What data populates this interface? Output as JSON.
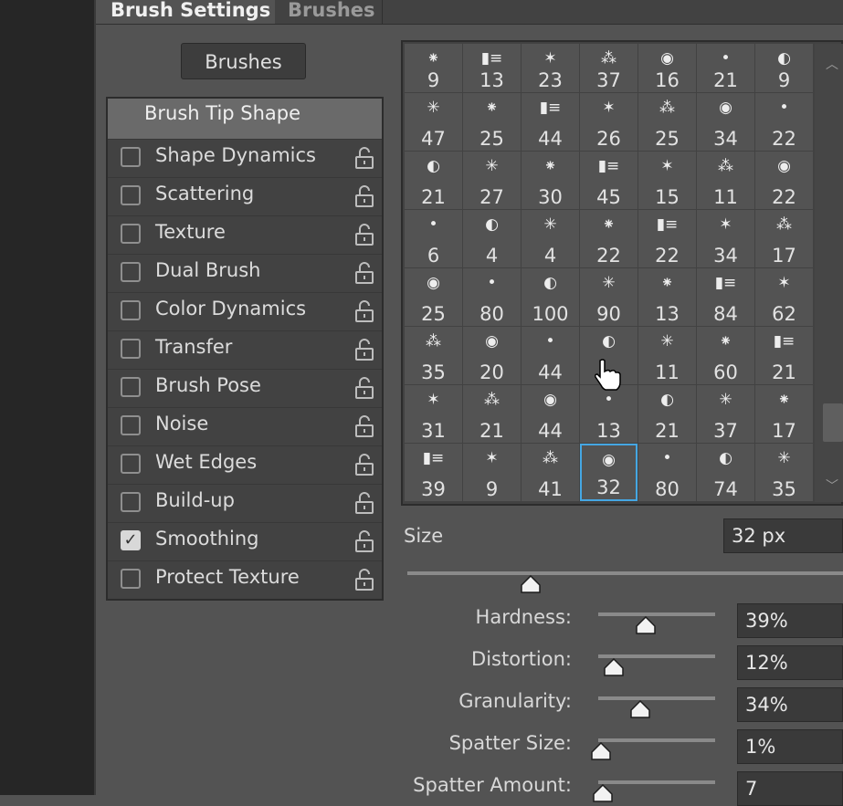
{
  "tabs": [
    {
      "label": "Brush Settings"
    },
    {
      "label": "Brushes"
    }
  ],
  "brushes_button": "Brushes",
  "tip_shape": "Brush Tip Shape",
  "options": [
    {
      "label": "Shape Dynamics",
      "checked": false
    },
    {
      "label": "Scattering",
      "checked": false
    },
    {
      "label": "Texture",
      "checked": false
    },
    {
      "label": "Dual Brush",
      "checked": false
    },
    {
      "label": "Color Dynamics",
      "checked": false
    },
    {
      "label": "Transfer",
      "checked": false
    },
    {
      "label": "Brush Pose",
      "checked": false
    },
    {
      "label": "Noise",
      "checked": false
    },
    {
      "label": "Wet Edges",
      "checked": false
    },
    {
      "label": "Build-up",
      "checked": false
    },
    {
      "label": "Smoothing",
      "checked": true
    },
    {
      "label": "Protect Texture",
      "checked": false
    }
  ],
  "brush_grid": [
    [
      "9",
      "13",
      "23",
      "37",
      "16",
      "21",
      "9"
    ],
    [
      "47",
      "25",
      "44",
      "26",
      "25",
      "34",
      "22"
    ],
    [
      "21",
      "27",
      "30",
      "45",
      "15",
      "11",
      "22"
    ],
    [
      "6",
      "4",
      "4",
      "22",
      "22",
      "34",
      "17"
    ],
    [
      "25",
      "80",
      "100",
      "90",
      "13",
      "84",
      "62"
    ],
    [
      "35",
      "20",
      "44",
      "",
      "11",
      "60",
      "21"
    ],
    [
      "31",
      "21",
      "44",
      "13",
      "21",
      "37",
      "17"
    ],
    [
      "39",
      "9",
      "41",
      "32",
      "80",
      "74",
      "35"
    ]
  ],
  "selected_brush": "32",
  "size": {
    "label": "Size",
    "value": "32 px",
    "level": 0.3
  },
  "params": [
    {
      "label": "Hardness:",
      "value": "39%",
      "level": 0.39
    },
    {
      "label": "Distortion:",
      "value": "12%",
      "level": 0.12
    },
    {
      "label": "Granularity:",
      "value": "34%",
      "level": 0.34
    },
    {
      "label": "Spatter Size:",
      "value": "1%",
      "level": 0.01
    },
    {
      "label": "Spatter Amount:",
      "value": "7",
      "level": 0.02
    }
  ],
  "colors": {
    "accent": "#45a7e3",
    "panel": "#535353",
    "dark": "#424242"
  },
  "icons": [
    "lock-icon",
    "checkmark-icon",
    "scroll-up-icon",
    "scroll-down-icon",
    "hand-cursor-icon"
  ]
}
